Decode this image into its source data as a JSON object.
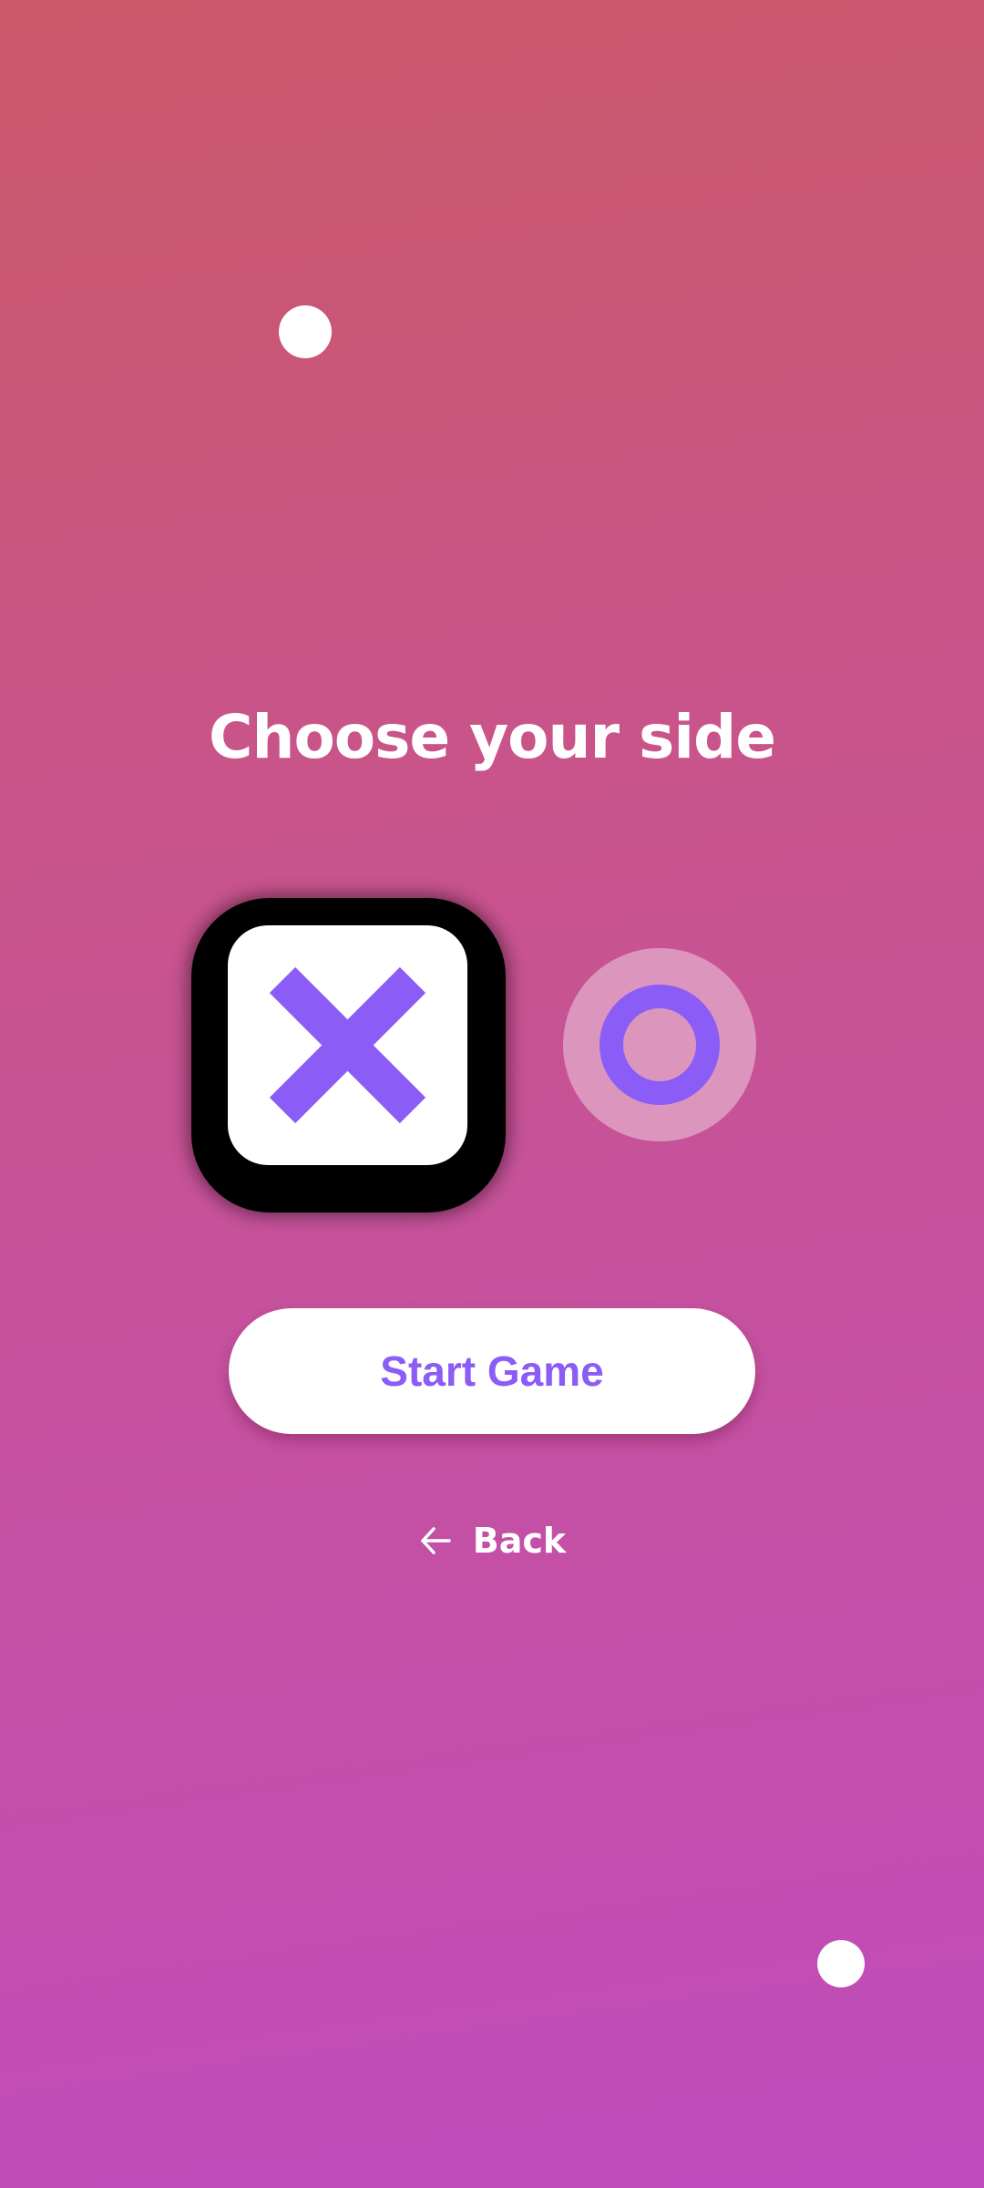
{
  "screen": {
    "title": "Choose your side"
  },
  "sides": [
    {
      "id": "x",
      "icon": "x-mark-icon",
      "selected": true
    },
    {
      "id": "o",
      "icon": "o-ring-icon",
      "selected": false
    }
  ],
  "actions": {
    "start_label": "Start Game",
    "back_label": "Back",
    "back_icon": "arrow-left-icon"
  },
  "colors": {
    "accent": "#8b5cf6",
    "background_top": "#cb5868",
    "background_bottom": "#bf4bbd",
    "selected_border": "#000000",
    "unselected_halo": "#dc96bd"
  }
}
